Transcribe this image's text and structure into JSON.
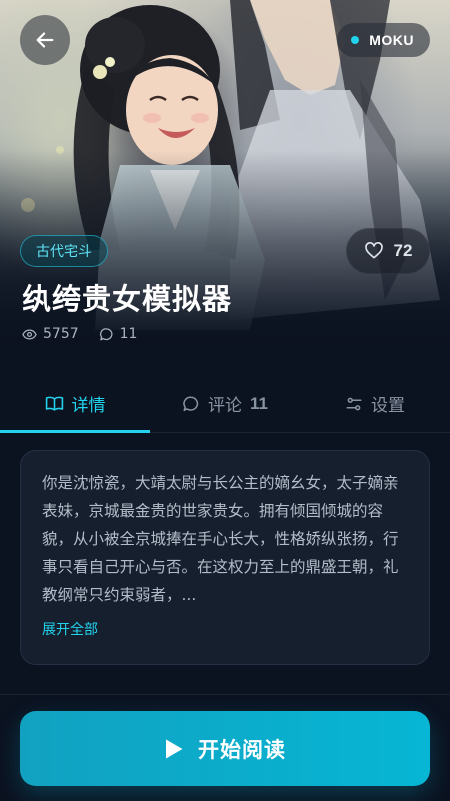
{
  "header": {
    "back_label": "",
    "brand": "MOKU"
  },
  "story": {
    "genre": "古代宅斗",
    "title": "纨绔贵女模拟器",
    "likes": "72",
    "views": "5757",
    "comments": "11"
  },
  "tabs": [
    {
      "label": "详情",
      "icon": "book-open-icon",
      "active": true
    },
    {
      "label": "评论",
      "count": "11",
      "icon": "comment-icon",
      "active": false
    },
    {
      "label": "设置",
      "icon": "sliders-icon",
      "active": false
    }
  ],
  "synopsis": {
    "text": "你是沈惊瓷，大靖太尉与长公主的嫡幺女，太子嫡亲表妹，京城最金贵的世家贵女。拥有倾国倾城的容貌，从小被全京城捧在手心长大，性格娇纵张扬，行事只看自己开心与否。在这权力至上的鼎盛王朝，礼教纲常只约束弱者，...",
    "expand_label": "展开全部"
  },
  "cta": {
    "label": "开始阅读",
    "icon": "play-icon"
  },
  "colors": {
    "accent": "#22d3ee",
    "background": "#0b1220",
    "card": "#161f2e",
    "button_start": "#12a1c1",
    "button_end": "#06b6d4"
  }
}
